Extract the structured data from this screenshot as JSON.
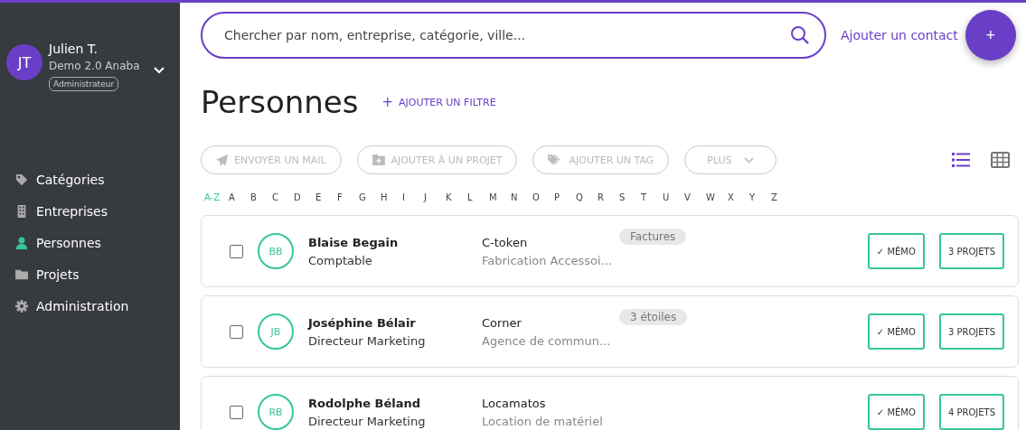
{
  "user": {
    "initials": "JT",
    "name": "Julien T.",
    "organization": "Demo 2.0 Anaba",
    "role": "Administrateur"
  },
  "sidebar": {
    "items": [
      {
        "label": "Catégories",
        "kind": "tag",
        "selected": false
      },
      {
        "label": "Entreprises",
        "kind": "building",
        "selected": false
      },
      {
        "label": "Personnes",
        "kind": "person",
        "selected": true
      },
      {
        "label": "Projets",
        "kind": "folder",
        "selected": false
      },
      {
        "label": "Administration",
        "kind": "gear",
        "selected": false
      }
    ]
  },
  "search": {
    "placeholder": "Chercher par nom, entreprise, catégorie, ville..."
  },
  "add_contact": {
    "label": "Ajouter un contact",
    "fab": "+"
  },
  "page_title": "Personnes",
  "add_filter": {
    "icon": "+",
    "label": "AJOUTER UN FILTRE"
  },
  "actions": [
    {
      "label": "ENVOYER UN MAIL",
      "kind": "send"
    },
    {
      "label": "AJOUTER À UN PROJET",
      "kind": "folder"
    },
    {
      "label": "AJOUTER UN TAG",
      "kind": "tag"
    },
    {
      "label": "PLUS",
      "kind": "more"
    }
  ],
  "views": [
    {
      "kind": "list",
      "selected": true
    },
    {
      "kind": "grid",
      "selected": false
    }
  ],
  "letters": [
    {
      "label": "A-Z",
      "selected": true
    },
    {
      "label": "A",
      "selected": false
    },
    {
      "label": "B",
      "selected": false
    },
    {
      "label": "C",
      "selected": false
    },
    {
      "label": "D",
      "selected": false
    },
    {
      "label": "E",
      "selected": false
    },
    {
      "label": "F",
      "selected": false
    },
    {
      "label": "G",
      "selected": false
    },
    {
      "label": "H",
      "selected": false
    },
    {
      "label": "I",
      "selected": false
    },
    {
      "label": "J",
      "selected": false
    },
    {
      "label": "K",
      "selected": false
    },
    {
      "label": "L",
      "selected": false
    },
    {
      "label": "M",
      "selected": false
    },
    {
      "label": "N",
      "selected": false
    },
    {
      "label": "O",
      "selected": false
    },
    {
      "label": "P",
      "selected": false
    },
    {
      "label": "Q",
      "selected": false
    },
    {
      "label": "R",
      "selected": false
    },
    {
      "label": "S",
      "selected": false
    },
    {
      "label": "T",
      "selected": false
    },
    {
      "label": "U",
      "selected": false
    },
    {
      "label": "V",
      "selected": false
    },
    {
      "label": "W",
      "selected": false
    },
    {
      "label": "X",
      "selected": false
    },
    {
      "label": "Y",
      "selected": false
    },
    {
      "label": "Z",
      "selected": false
    }
  ],
  "contacts": [
    {
      "checked": false,
      "initials": "BB",
      "name": "Blaise Begain",
      "job": "Comptable",
      "company": "C-token",
      "activity": "Fabrication Accessoi...",
      "tag": "Factures",
      "memo": "✓ MÉMO",
      "projects": "3 PROJETS"
    },
    {
      "checked": false,
      "initials": "JB",
      "name": "Joséphine Bélair",
      "job": "Directeur Marketing",
      "company": "Corner",
      "activity": "Agence de commun...",
      "tag": "3 étoiles",
      "memo": "✓ MÉMO",
      "projects": "3 PROJETS"
    },
    {
      "checked": false,
      "initials": "RB",
      "name": "Rodolphe Béland",
      "job": "Directeur Marketing",
      "company": "Locamatos",
      "activity": "Location de matériel",
      "memo": "✓ MÉMO",
      "projects": "4 PROJETS"
    }
  ]
}
